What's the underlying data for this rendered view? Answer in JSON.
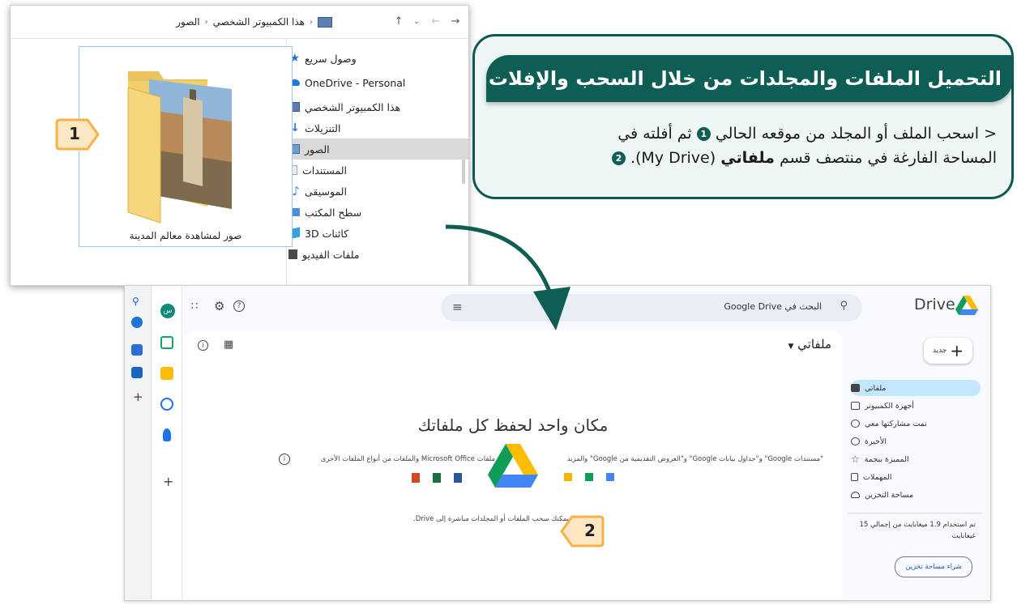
{
  "explorer": {
    "breadcrumb": {
      "current": "الصور",
      "parent": "هذا الكمبيوتر الشخصي"
    },
    "nav_items": [
      {
        "label": "وصول سريع",
        "icon": "star-icon",
        "color": "#2f6fd6"
      },
      {
        "label": "OneDrive - Personal",
        "icon": "cloud-icon",
        "color": "#1f7ad8"
      },
      {
        "label": "هذا الكمبيوتر الشخصي",
        "icon": "pc-icon",
        "color": "#5d7fb0"
      },
      {
        "label": "التنزيلات",
        "icon": "download-icon",
        "color": "#2a74d4"
      },
      {
        "label": "الصور",
        "icon": "pictures-icon",
        "color": "#6a9fd0"
      },
      {
        "label": "المستندات",
        "icon": "document-icon",
        "color": "#9aa7b8"
      },
      {
        "label": "الموسيقى",
        "icon": "music-icon",
        "color": "#2f86de"
      },
      {
        "label": "سطح المكتب",
        "icon": "desktop-icon",
        "color": "#4a90d9"
      },
      {
        "label": "كائنات 3D",
        "icon": "cube-icon",
        "color": "#36a3e0"
      },
      {
        "label": "ملفات الفيديو",
        "icon": "video-icon",
        "color": "#4a4a4a"
      }
    ],
    "folder_label": "صور لمشاهدة معالم المدينة"
  },
  "callout": {
    "title": "التحميل الملفات والمجلدات من خلال السحب والإفلات",
    "line1_part1": "< اسحب الملف أو المجلد من موقعه الحالي",
    "line1_num": "1",
    "line1_part2": "ثم أفلته في",
    "line2_part1": "المساحة الفارغة في منتصف قسم",
    "line2_bold": "ملفاتي",
    "line2_part2": "(My Drive).",
    "line2_num": "2"
  },
  "markers": {
    "m1": "1",
    "m2": "2"
  },
  "drive": {
    "logo_text": "Drive",
    "search_placeholder": "البحث في Google Drive",
    "new_button": "جديد",
    "nav": [
      {
        "label": "ملفاتي",
        "icon": "my-drive-icon"
      },
      {
        "label": "أجهزة الكمبيوتر",
        "icon": "computers-icon"
      },
      {
        "label": "تمت مشاركتها معي",
        "icon": "shared-icon"
      },
      {
        "label": "الأخيرة",
        "icon": "clock-icon"
      },
      {
        "label": "المميزة بنجمة",
        "icon": "star-outline-icon"
      },
      {
        "label": "المهملات",
        "icon": "trash-icon"
      },
      {
        "label": "مساحة التخزين",
        "icon": "cloud-outline-icon"
      }
    ],
    "storage_text": "تم استخدام 1.9 ميغابايت من إجمالي 15 غيغابايت",
    "buy_storage": "شراء مساحة تخزين",
    "breadcrumb": "ملفاتي",
    "empty_title": "مكان واحد لحفظ كل ملفاتك",
    "left_caption": "ملفات Microsoft Office والملفات من أنواع الملفات الأخرى",
    "right_caption": "\"مستندات Google\" و\"جداول بيانات Google\" و\"العروض التقديمية من Google\" والمزيد",
    "drop_hint": "يمكنك سحب الملفات أو المجلدات مباشرة إلى Drive.",
    "avatar": "س"
  },
  "colors": {
    "teal": "#0f5e55",
    "marker_orange": "#f5b24a",
    "marker_fill": "#fde7c2"
  }
}
